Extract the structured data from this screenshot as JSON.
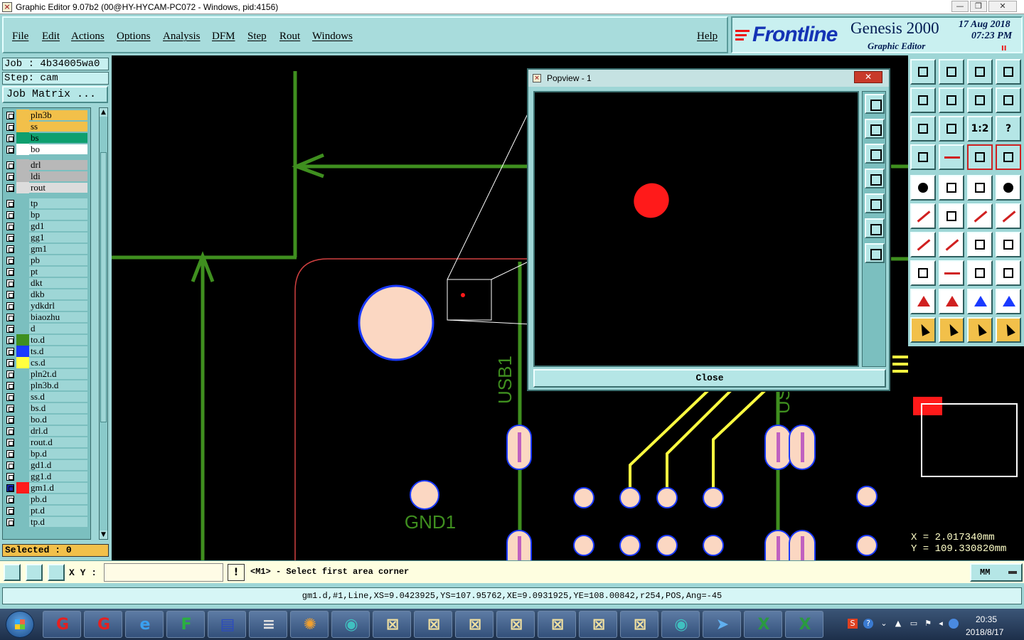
{
  "window": {
    "title": "Graphic Editor 9.07b2 (00@HY-HYCAM-PC072 - Windows, pid:4156)",
    "controls": {
      "minimize": "—",
      "restore": "❐",
      "close": "✕"
    }
  },
  "menu": {
    "file": "File",
    "edit": "Edit",
    "actions": "Actions",
    "options": "Options",
    "analysis": "Analysis",
    "dfm": "DFM",
    "step": "Step",
    "rout": "Rout",
    "windows": "Windows",
    "help": "Help"
  },
  "brand": {
    "logo": "Frontline",
    "title": "Genesis 2000",
    "subtitle": "Graphic Editor",
    "date": "17 Aug 2018",
    "time": "07:23 PM",
    "marker": "II"
  },
  "left_panel": {
    "job": "Job : 4b34005wa0",
    "step": "Step: cam",
    "job_matrix": "Job Matrix ...",
    "selected": "Selected : 0",
    "layers": [
      {
        "name": "pln3b",
        "color": "#f2c04a",
        "row_color": "#f2c04a"
      },
      {
        "name": "ss",
        "color": "#f2c04a",
        "row_color": "#f2c04a"
      },
      {
        "name": "bs",
        "color": "#0e9f6f",
        "row_color": "#0e9f6f"
      },
      {
        "name": "bo",
        "color": "#ffffff",
        "row_color": "#ffffff"
      },
      {
        "name": "drl",
        "color": "#b8b8b8",
        "row_color": "#b8b8b8"
      },
      {
        "name": "ldi",
        "color": "#b8b8b8",
        "row_color": "#b8b8b8"
      },
      {
        "name": "rout",
        "color": "#dcdcdc",
        "row_color": "#dcdcdc"
      },
      {
        "name": "tp",
        "color": "",
        "row_color": ""
      },
      {
        "name": "bp",
        "color": "",
        "row_color": ""
      },
      {
        "name": "gd1",
        "color": "",
        "row_color": ""
      },
      {
        "name": "gg1",
        "color": "",
        "row_color": ""
      },
      {
        "name": "gm1",
        "color": "",
        "row_color": ""
      },
      {
        "name": "pb",
        "color": "",
        "row_color": ""
      },
      {
        "name": "pt",
        "color": "",
        "row_color": ""
      },
      {
        "name": "dkt",
        "color": "",
        "row_color": ""
      },
      {
        "name": "dkb",
        "color": "",
        "row_color": ""
      },
      {
        "name": "ydkdrl",
        "color": "",
        "row_color": ""
      },
      {
        "name": "biaozhu",
        "color": "",
        "row_color": ""
      },
      {
        "name": "d",
        "color": "",
        "row_color": ""
      },
      {
        "name": "to.d",
        "color": "#3f8f1f",
        "row_color": ""
      },
      {
        "name": "ts.d",
        "color": "#1a3aff",
        "row_color": ""
      },
      {
        "name": "cs.d",
        "color": "#ffff40",
        "row_color": ""
      },
      {
        "name": "pln2t.d",
        "color": "",
        "row_color": ""
      },
      {
        "name": "pln3b.d",
        "color": "",
        "row_color": ""
      },
      {
        "name": "ss.d",
        "color": "",
        "row_color": ""
      },
      {
        "name": "bs.d",
        "color": "",
        "row_color": ""
      },
      {
        "name": "bo.d",
        "color": "",
        "row_color": ""
      },
      {
        "name": "drl.d",
        "color": "",
        "row_color": ""
      },
      {
        "name": "rout.d",
        "color": "",
        "row_color": ""
      },
      {
        "name": "bp.d",
        "color": "",
        "row_color": ""
      },
      {
        "name": "gd1.d",
        "color": "",
        "row_color": ""
      },
      {
        "name": "gg1.d",
        "color": "",
        "row_color": ""
      },
      {
        "name": "gm1.d",
        "color": "#ff1a1a",
        "row_color": "",
        "active": true
      },
      {
        "name": "pb.d",
        "color": "",
        "row_color": ""
      },
      {
        "name": "pt.d",
        "color": "",
        "row_color": ""
      },
      {
        "name": "tp.d",
        "color": "",
        "row_color": ""
      }
    ]
  },
  "canvas": {
    "labels": {
      "usb1": "USB1",
      "gnd1": "GND1",
      "usb_partial": "US"
    },
    "colors": {
      "trace": "#3f8f1f",
      "pad": "#fbd7c2",
      "pad_outline": "#1a3aff",
      "via": "#c060c0",
      "yellow_trace": "#ffff40",
      "outline": "#d04040",
      "background": "#000000"
    }
  },
  "popview": {
    "title": "Popview - 1",
    "close_x": "✕",
    "close_button": "Close",
    "feature_color": "#ff1a1a"
  },
  "right_panel": {
    "tools": [
      "move-up-icon",
      "move-down-icon",
      "home-icon",
      "window-icon",
      "move-left-icon",
      "move-right-icon",
      "flip-icon",
      "snake-icon",
      "fit-height-icon",
      "fit-all-icon",
      "scale-1-2-icon",
      "help-icon",
      "tools-icon",
      "red-probe-icon",
      "layers-red-icon",
      "layers-red-2-icon",
      "select-pad-icon",
      "color-rect-icon",
      "ruler-icon",
      "black-circle-icon",
      "connect-icon",
      "cross-icon",
      "dot-line-icon",
      "dot-line-2-icon",
      "angle-icon",
      "slant-line-icon",
      "rotate-icon",
      "fiducial-icon",
      "box-pad-icon",
      "horizontal-line-icon",
      "dimension-icon",
      "shapes-icon",
      "triangle-small-icon",
      "triangle-red-icon",
      "triangle-blue-icon",
      "triangle-red-blue-icon",
      "pointer-icon",
      "pointer-frame-icon",
      "pointer-circle-icon",
      "path-icon"
    ],
    "scale_label": "1:2",
    "help_label": "?",
    "coord_x": "X = 2.017340mm",
    "coord_y": "Y = 109.330820mm"
  },
  "command_bar": {
    "xy_label": "X Y :",
    "xy_value": "",
    "excl": "!",
    "prompt": "<M1> - Select first area corner",
    "units": "MM"
  },
  "status": {
    "text": "gm1.d,#1,Line,XS=9.0423925,YS=107.95762,XE=9.0931925,YE=108.00842,r254,POS,Ang=-45"
  },
  "taskbar": {
    "time": "20:35",
    "date": "2018/8/17",
    "apps": [
      "genesis-red-icon",
      "genesis-red-icon",
      "internet-explorer-icon",
      "frontline-icon",
      "save-icon",
      "scanner-icon",
      "shell-icon",
      "eye-icon",
      "editor-window-icon",
      "editor-window-icon",
      "editor-window-icon",
      "editor-window-icon",
      "editor-window-icon",
      "editor-window-icon",
      "editor-window-icon",
      "eye-icon",
      "bird-icon",
      "excel-icon",
      "excel-icon"
    ]
  }
}
